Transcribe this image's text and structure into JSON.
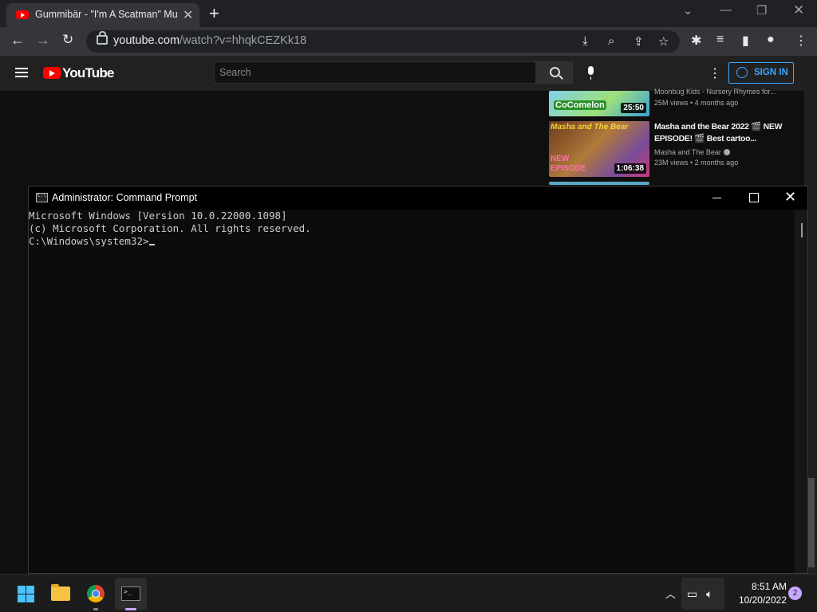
{
  "browser": {
    "tab_title": "Gummibär - \"I'm A Scatman\" Mu",
    "url_domain": "youtube.com",
    "url_path": "/watch?v=hhqkCEZKk18"
  },
  "youtube": {
    "logo_text": "YouTube",
    "search_placeholder": "Search",
    "signin_label": "SIGN IN",
    "videos": [
      {
        "title": "",
        "channel": "Moonbug Kids - Nursery Rhymes for...",
        "meta": "25M views • 4 months ago",
        "duration": "25:50",
        "thumb_text": "CoComelon"
      },
      {
        "title": "Masha and the Bear 2022 🎬 NEW EPISODE! 🎬 Best cartoo...",
        "channel": "Masha and The Bear",
        "meta": "23M views • 2 months ago",
        "duration": "1:06:38",
        "thumb_text_top": "Masha and The Bear",
        "thumb_text_bottom": "NEW EPISODE"
      }
    ]
  },
  "cmd": {
    "title": "Administrator: Command Prompt",
    "lines": [
      "Microsoft Windows [Version 10.0.22000.1098]",
      "(c) Microsoft Corporation. All rights reserved.",
      "C:\\Windows\\system32>"
    ]
  },
  "taskbar": {
    "time": "8:51 AM",
    "date": "10/20/2022",
    "notification_count": "2"
  },
  "colors": {
    "youtube_red": "#ff0000",
    "signin_blue": "#3ea6ff",
    "windows_accent": "#4cc2ff"
  }
}
